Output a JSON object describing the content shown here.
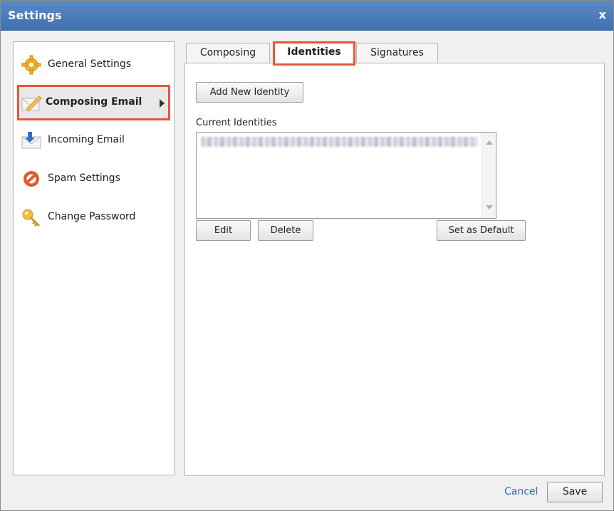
{
  "window": {
    "title": "Settings",
    "close_label": "x"
  },
  "sidebar": {
    "items": [
      {
        "label": "General Settings",
        "icon": "gear-icon"
      },
      {
        "label": "Composing Email",
        "icon": "envelope-pencil-icon",
        "active": true
      },
      {
        "label": "Incoming Email",
        "icon": "incoming-mail-icon"
      },
      {
        "label": "Spam Settings",
        "icon": "no-entry-icon"
      },
      {
        "label": "Change Password",
        "icon": "key-icon"
      }
    ]
  },
  "tabs": [
    {
      "label": "Composing"
    },
    {
      "label": "Identities",
      "active": true
    },
    {
      "label": "Signatures"
    }
  ],
  "identities": {
    "add_button": "Add New Identity",
    "current_label": "Current Identities",
    "edit_button": "Edit",
    "delete_button": "Delete",
    "default_button": "Set as Default"
  },
  "footer": {
    "cancel_label": "Cancel",
    "save_label": "Save"
  },
  "colors": {
    "title_bar": "#3f71b0",
    "highlight": "#e8543a",
    "link": "#2f6db5"
  }
}
